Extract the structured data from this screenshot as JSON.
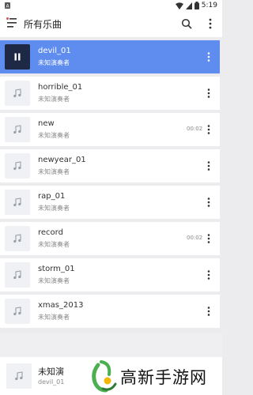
{
  "statusbar": {
    "time": "5:19"
  },
  "appbar": {
    "title": "所有乐曲"
  },
  "songs": [
    {
      "name": "devil_01",
      "artist": "未知演奏者",
      "duration": ""
    },
    {
      "name": "horrible_01",
      "artist": "未知演奏者",
      "duration": ""
    },
    {
      "name": "new",
      "artist": "未知演奏者",
      "duration": "00:02"
    },
    {
      "name": "newyear_01",
      "artist": "未知演奏者",
      "duration": ""
    },
    {
      "name": "rap_01",
      "artist": "未知演奏者",
      "duration": ""
    },
    {
      "name": "record",
      "artist": "未知演奏者",
      "duration": "00:02"
    },
    {
      "name": "storm_01",
      "artist": "未知演奏者",
      "duration": ""
    },
    {
      "name": "xmas_2013",
      "artist": "未知演奏者",
      "duration": ""
    }
  ],
  "now_playing": {
    "title": "未知演",
    "subtitle": "devil_01"
  },
  "watermark": {
    "text": "高新手游网"
  },
  "colors": {
    "accent": "#5f8def",
    "active_thumb": "#1e2a45"
  },
  "icons": {
    "menu": "menu-lines-icon",
    "search": "search-icon",
    "more": "more-vert-icon",
    "note": "music-note-icon",
    "pause": "pause-icon"
  }
}
